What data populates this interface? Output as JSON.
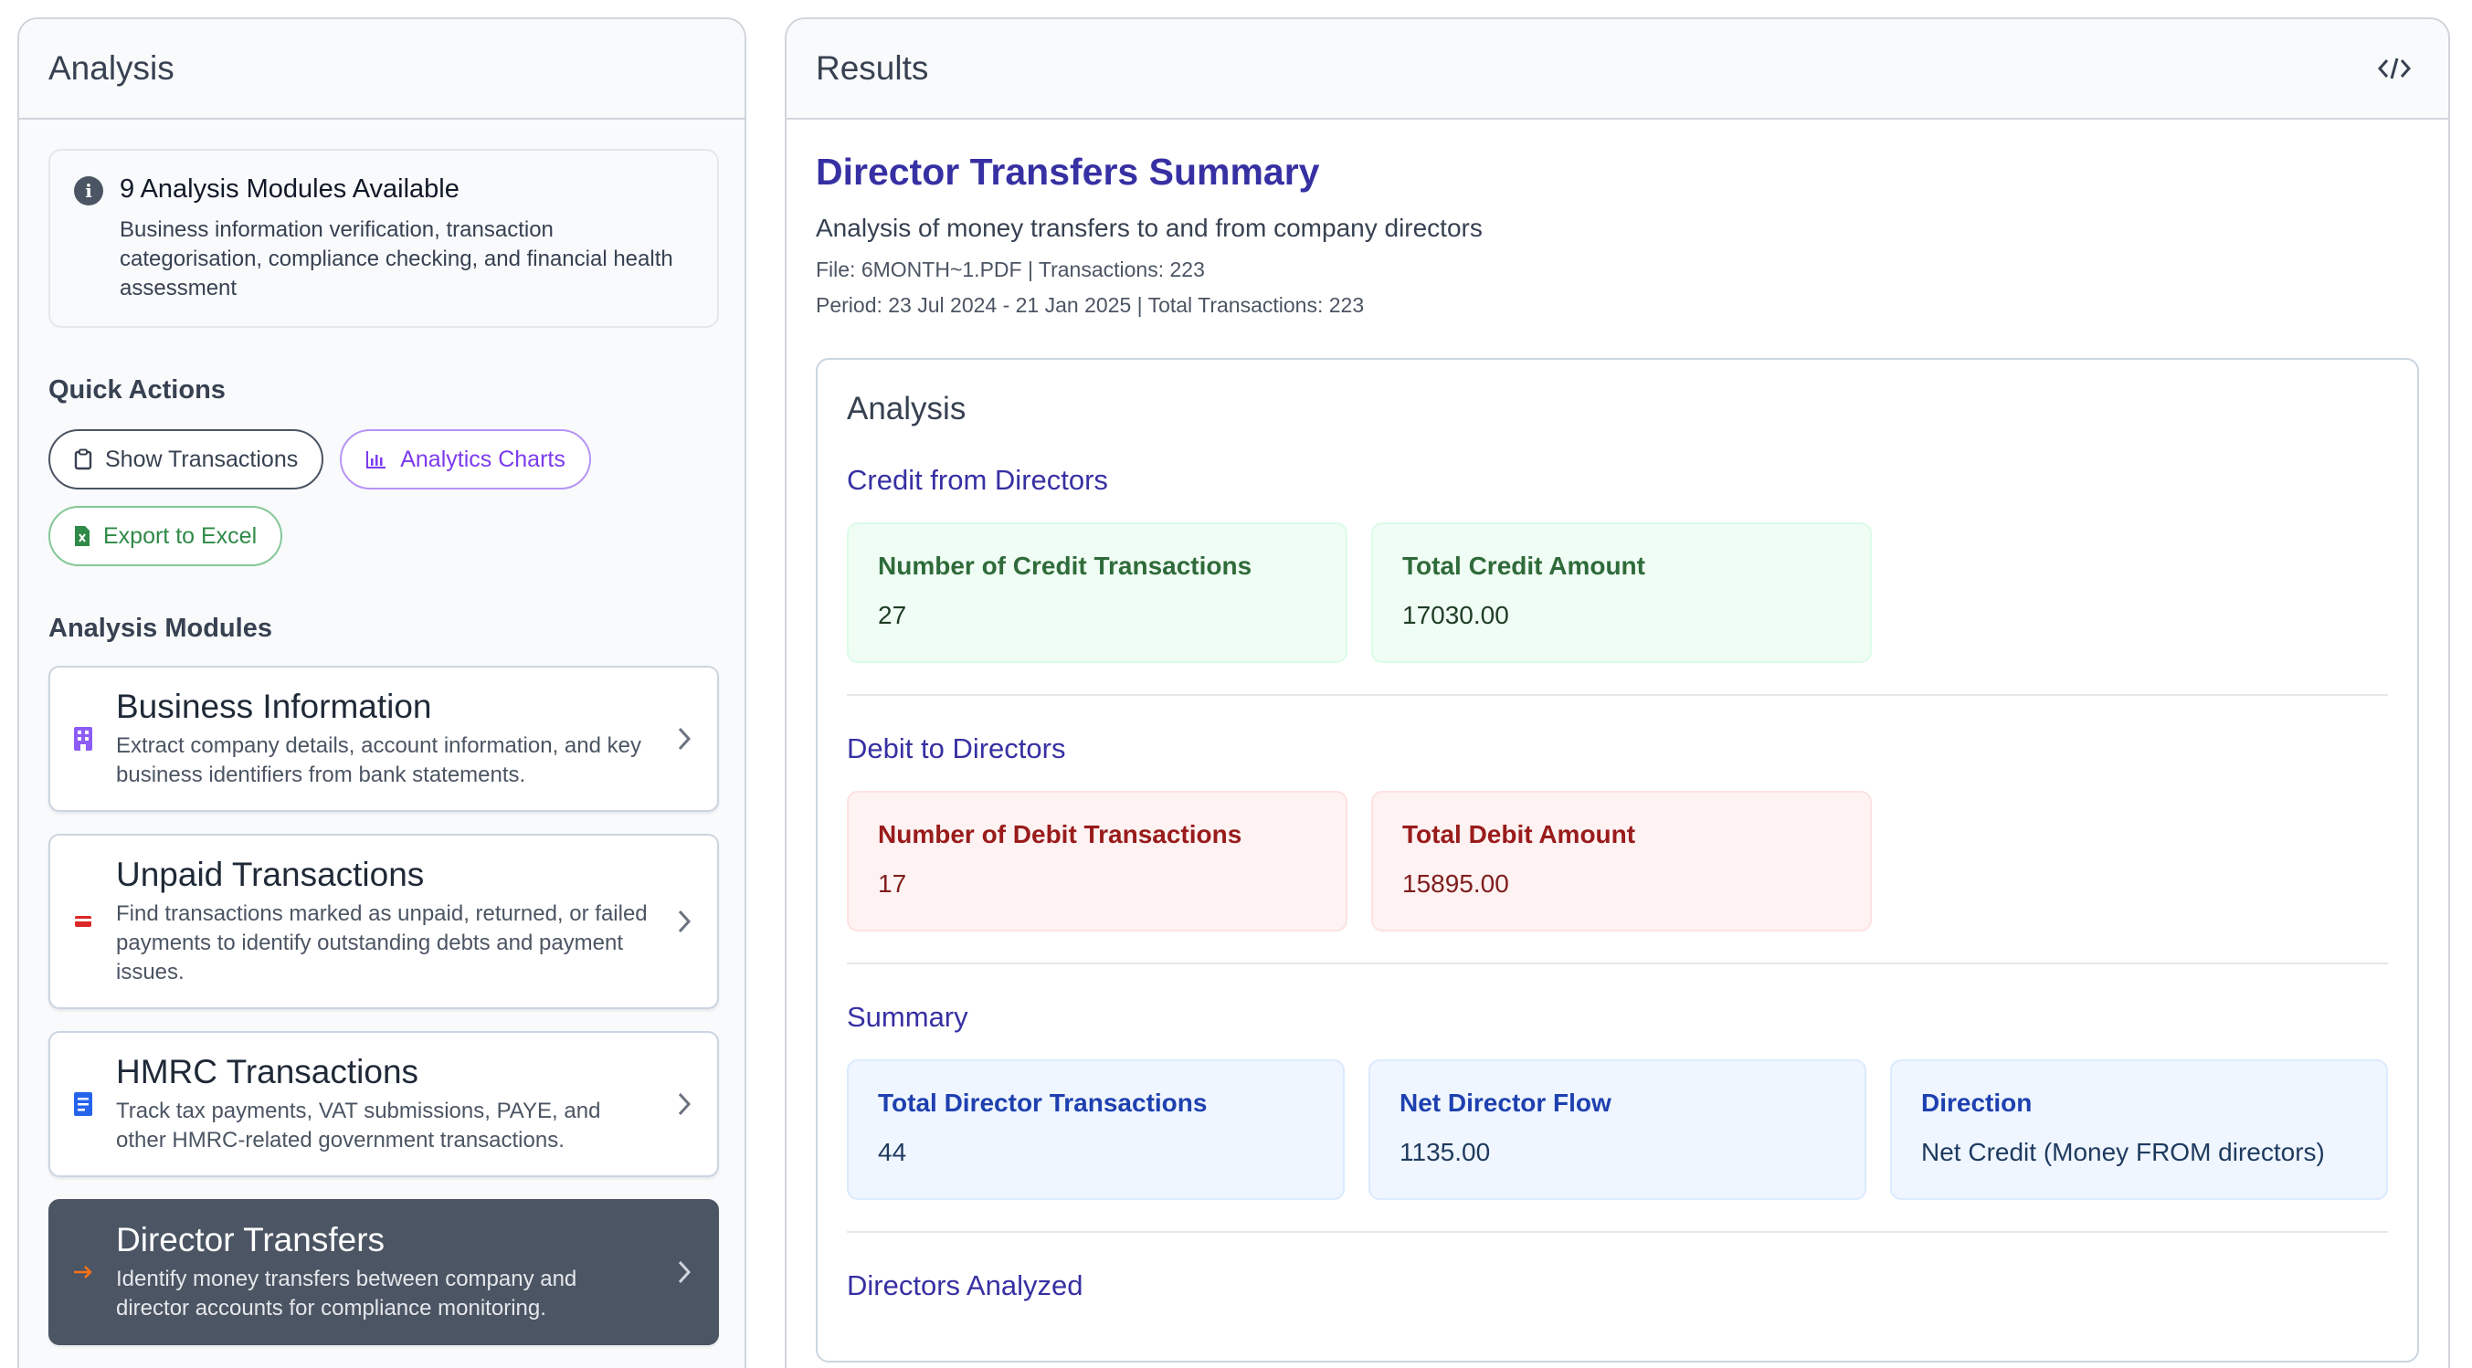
{
  "left_panel": {
    "title": "Analysis",
    "info": {
      "title": "9 Analysis Modules Available",
      "description": "Business information verification, transaction categorisation, compliance checking, and financial health assessment"
    },
    "quick_actions": {
      "label": "Quick Actions",
      "show_transactions": "Show Transactions",
      "analytics_charts": "Analytics Charts",
      "export_excel": "Export to Excel"
    },
    "modules_label": "Analysis Modules",
    "modules": [
      {
        "title": "Business Information",
        "description": "Extract company details, account information, and key business identifiers from bank statements.",
        "icon": "building-icon",
        "color": "#8b5cf6"
      },
      {
        "title": "Unpaid Transactions",
        "description": "Find transactions marked as unpaid, returned, or failed payments to identify outstanding debts and payment issues.",
        "icon": "credit-card-icon",
        "color": "#dc2626"
      },
      {
        "title": "HMRC Transactions",
        "description": "Track tax payments, VAT submissions, PAYE, and other HMRC-related government transactions.",
        "icon": "document-icon",
        "color": "#2563eb"
      },
      {
        "title": "Director Transfers",
        "description": "Identify money transfers between company and director accounts for compliance monitoring.",
        "icon": "arrow-right-icon",
        "color": "#f97316"
      }
    ]
  },
  "right_panel": {
    "title": "Results",
    "summary_title": "Director Transfers Summary",
    "summary_subtitle": "Analysis of money transfers to and from company directors",
    "meta_file": "File: 6MONTH~1.PDF | Transactions: 223",
    "meta_period": "Period: 23 Jul 2024 - 21 Jan 2025 | Total Transactions: 223",
    "analysis": {
      "title": "Analysis",
      "credit": {
        "title": "Credit from Directors",
        "count_label": "Number of Credit Transactions",
        "count_value": "27",
        "amount_label": "Total Credit Amount",
        "amount_value": "17030.00"
      },
      "debit": {
        "title": "Debit to Directors",
        "count_label": "Number of Debit Transactions",
        "count_value": "17",
        "amount_label": "Total Debit Amount",
        "amount_value": "15895.00"
      },
      "summary": {
        "title": "Summary",
        "total_label": "Total Director Transactions",
        "total_value": "44",
        "net_label": "Net Director Flow",
        "net_value": "1135.00",
        "direction_label": "Direction",
        "direction_value": "Net Credit (Money FROM directors)"
      },
      "directors_title": "Directors Analyzed"
    }
  }
}
